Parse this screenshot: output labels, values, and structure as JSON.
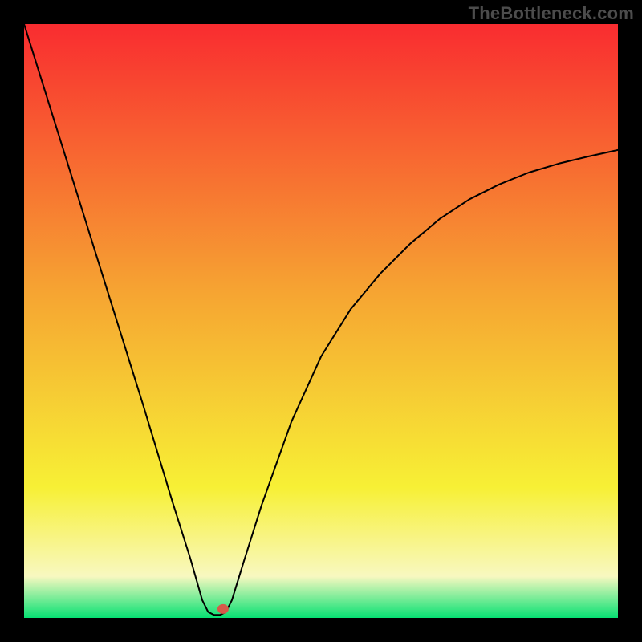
{
  "watermark": "TheBottleneck.com",
  "chart_data": {
    "type": "line",
    "title": "",
    "xlabel": "",
    "ylabel": "",
    "xlim": [
      0,
      1
    ],
    "ylim": [
      0,
      1
    ],
    "grid": false,
    "legend": false,
    "background_gradient": {
      "top": "#f92c30",
      "mid_upper": "#f6a432",
      "mid": "#f7f035",
      "mid_lower": "#f8f8c0",
      "bottom": "#07e173"
    },
    "series": [
      {
        "name": "bottleneck-curve",
        "color": "#000000",
        "stroke_width": 2,
        "x": [
          0.0,
          0.05,
          0.1,
          0.15,
          0.2,
          0.25,
          0.28,
          0.3,
          0.31,
          0.32,
          0.33,
          0.34,
          0.35,
          0.37,
          0.4,
          0.45,
          0.5,
          0.55,
          0.6,
          0.65,
          0.7,
          0.75,
          0.8,
          0.85,
          0.9,
          0.95,
          1.0
        ],
        "y": [
          1.0,
          0.84,
          0.68,
          0.52,
          0.36,
          0.195,
          0.1,
          0.03,
          0.01,
          0.005,
          0.005,
          0.01,
          0.03,
          0.095,
          0.19,
          0.33,
          0.44,
          0.52,
          0.58,
          0.63,
          0.672,
          0.705,
          0.73,
          0.75,
          0.765,
          0.777,
          0.788
        ]
      }
    ],
    "marker": {
      "name": "optimum-point",
      "x": 0.335,
      "y": 0.015,
      "color": "#d65a4a",
      "rx": 7,
      "ry": 6
    }
  }
}
